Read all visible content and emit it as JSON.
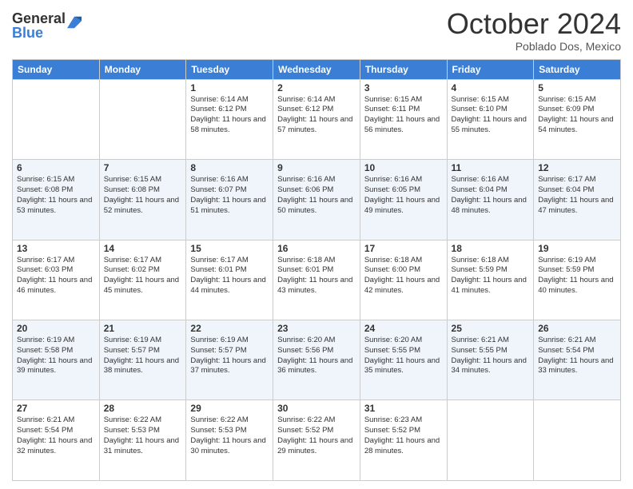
{
  "header": {
    "logo_general": "General",
    "logo_blue": "Blue",
    "month_title": "October 2024",
    "location": "Poblado Dos, Mexico"
  },
  "days_of_week": [
    "Sunday",
    "Monday",
    "Tuesday",
    "Wednesday",
    "Thursday",
    "Friday",
    "Saturday"
  ],
  "weeks": [
    [
      {
        "day": "",
        "sunrise": "",
        "sunset": "",
        "daylight": ""
      },
      {
        "day": "",
        "sunrise": "",
        "sunset": "",
        "daylight": ""
      },
      {
        "day": "1",
        "sunrise": "Sunrise: 6:14 AM",
        "sunset": "Sunset: 6:12 PM",
        "daylight": "Daylight: 11 hours and 58 minutes."
      },
      {
        "day": "2",
        "sunrise": "Sunrise: 6:14 AM",
        "sunset": "Sunset: 6:12 PM",
        "daylight": "Daylight: 11 hours and 57 minutes."
      },
      {
        "day": "3",
        "sunrise": "Sunrise: 6:15 AM",
        "sunset": "Sunset: 6:11 PM",
        "daylight": "Daylight: 11 hours and 56 minutes."
      },
      {
        "day": "4",
        "sunrise": "Sunrise: 6:15 AM",
        "sunset": "Sunset: 6:10 PM",
        "daylight": "Daylight: 11 hours and 55 minutes."
      },
      {
        "day": "5",
        "sunrise": "Sunrise: 6:15 AM",
        "sunset": "Sunset: 6:09 PM",
        "daylight": "Daylight: 11 hours and 54 minutes."
      }
    ],
    [
      {
        "day": "6",
        "sunrise": "Sunrise: 6:15 AM",
        "sunset": "Sunset: 6:08 PM",
        "daylight": "Daylight: 11 hours and 53 minutes."
      },
      {
        "day": "7",
        "sunrise": "Sunrise: 6:15 AM",
        "sunset": "Sunset: 6:08 PM",
        "daylight": "Daylight: 11 hours and 52 minutes."
      },
      {
        "day": "8",
        "sunrise": "Sunrise: 6:16 AM",
        "sunset": "Sunset: 6:07 PM",
        "daylight": "Daylight: 11 hours and 51 minutes."
      },
      {
        "day": "9",
        "sunrise": "Sunrise: 6:16 AM",
        "sunset": "Sunset: 6:06 PM",
        "daylight": "Daylight: 11 hours and 50 minutes."
      },
      {
        "day": "10",
        "sunrise": "Sunrise: 6:16 AM",
        "sunset": "Sunset: 6:05 PM",
        "daylight": "Daylight: 11 hours and 49 minutes."
      },
      {
        "day": "11",
        "sunrise": "Sunrise: 6:16 AM",
        "sunset": "Sunset: 6:04 PM",
        "daylight": "Daylight: 11 hours and 48 minutes."
      },
      {
        "day": "12",
        "sunrise": "Sunrise: 6:17 AM",
        "sunset": "Sunset: 6:04 PM",
        "daylight": "Daylight: 11 hours and 47 minutes."
      }
    ],
    [
      {
        "day": "13",
        "sunrise": "Sunrise: 6:17 AM",
        "sunset": "Sunset: 6:03 PM",
        "daylight": "Daylight: 11 hours and 46 minutes."
      },
      {
        "day": "14",
        "sunrise": "Sunrise: 6:17 AM",
        "sunset": "Sunset: 6:02 PM",
        "daylight": "Daylight: 11 hours and 45 minutes."
      },
      {
        "day": "15",
        "sunrise": "Sunrise: 6:17 AM",
        "sunset": "Sunset: 6:01 PM",
        "daylight": "Daylight: 11 hours and 44 minutes."
      },
      {
        "day": "16",
        "sunrise": "Sunrise: 6:18 AM",
        "sunset": "Sunset: 6:01 PM",
        "daylight": "Daylight: 11 hours and 43 minutes."
      },
      {
        "day": "17",
        "sunrise": "Sunrise: 6:18 AM",
        "sunset": "Sunset: 6:00 PM",
        "daylight": "Daylight: 11 hours and 42 minutes."
      },
      {
        "day": "18",
        "sunrise": "Sunrise: 6:18 AM",
        "sunset": "Sunset: 5:59 PM",
        "daylight": "Daylight: 11 hours and 41 minutes."
      },
      {
        "day": "19",
        "sunrise": "Sunrise: 6:19 AM",
        "sunset": "Sunset: 5:59 PM",
        "daylight": "Daylight: 11 hours and 40 minutes."
      }
    ],
    [
      {
        "day": "20",
        "sunrise": "Sunrise: 6:19 AM",
        "sunset": "Sunset: 5:58 PM",
        "daylight": "Daylight: 11 hours and 39 minutes."
      },
      {
        "day": "21",
        "sunrise": "Sunrise: 6:19 AM",
        "sunset": "Sunset: 5:57 PM",
        "daylight": "Daylight: 11 hours and 38 minutes."
      },
      {
        "day": "22",
        "sunrise": "Sunrise: 6:19 AM",
        "sunset": "Sunset: 5:57 PM",
        "daylight": "Daylight: 11 hours and 37 minutes."
      },
      {
        "day": "23",
        "sunrise": "Sunrise: 6:20 AM",
        "sunset": "Sunset: 5:56 PM",
        "daylight": "Daylight: 11 hours and 36 minutes."
      },
      {
        "day": "24",
        "sunrise": "Sunrise: 6:20 AM",
        "sunset": "Sunset: 5:55 PM",
        "daylight": "Daylight: 11 hours and 35 minutes."
      },
      {
        "day": "25",
        "sunrise": "Sunrise: 6:21 AM",
        "sunset": "Sunset: 5:55 PM",
        "daylight": "Daylight: 11 hours and 34 minutes."
      },
      {
        "day": "26",
        "sunrise": "Sunrise: 6:21 AM",
        "sunset": "Sunset: 5:54 PM",
        "daylight": "Daylight: 11 hours and 33 minutes."
      }
    ],
    [
      {
        "day": "27",
        "sunrise": "Sunrise: 6:21 AM",
        "sunset": "Sunset: 5:54 PM",
        "daylight": "Daylight: 11 hours and 32 minutes."
      },
      {
        "day": "28",
        "sunrise": "Sunrise: 6:22 AM",
        "sunset": "Sunset: 5:53 PM",
        "daylight": "Daylight: 11 hours and 31 minutes."
      },
      {
        "day": "29",
        "sunrise": "Sunrise: 6:22 AM",
        "sunset": "Sunset: 5:53 PM",
        "daylight": "Daylight: 11 hours and 30 minutes."
      },
      {
        "day": "30",
        "sunrise": "Sunrise: 6:22 AM",
        "sunset": "Sunset: 5:52 PM",
        "daylight": "Daylight: 11 hours and 29 minutes."
      },
      {
        "day": "31",
        "sunrise": "Sunrise: 6:23 AM",
        "sunset": "Sunset: 5:52 PM",
        "daylight": "Daylight: 11 hours and 28 minutes."
      },
      {
        "day": "",
        "sunrise": "",
        "sunset": "",
        "daylight": ""
      },
      {
        "day": "",
        "sunrise": "",
        "sunset": "",
        "daylight": ""
      }
    ]
  ]
}
